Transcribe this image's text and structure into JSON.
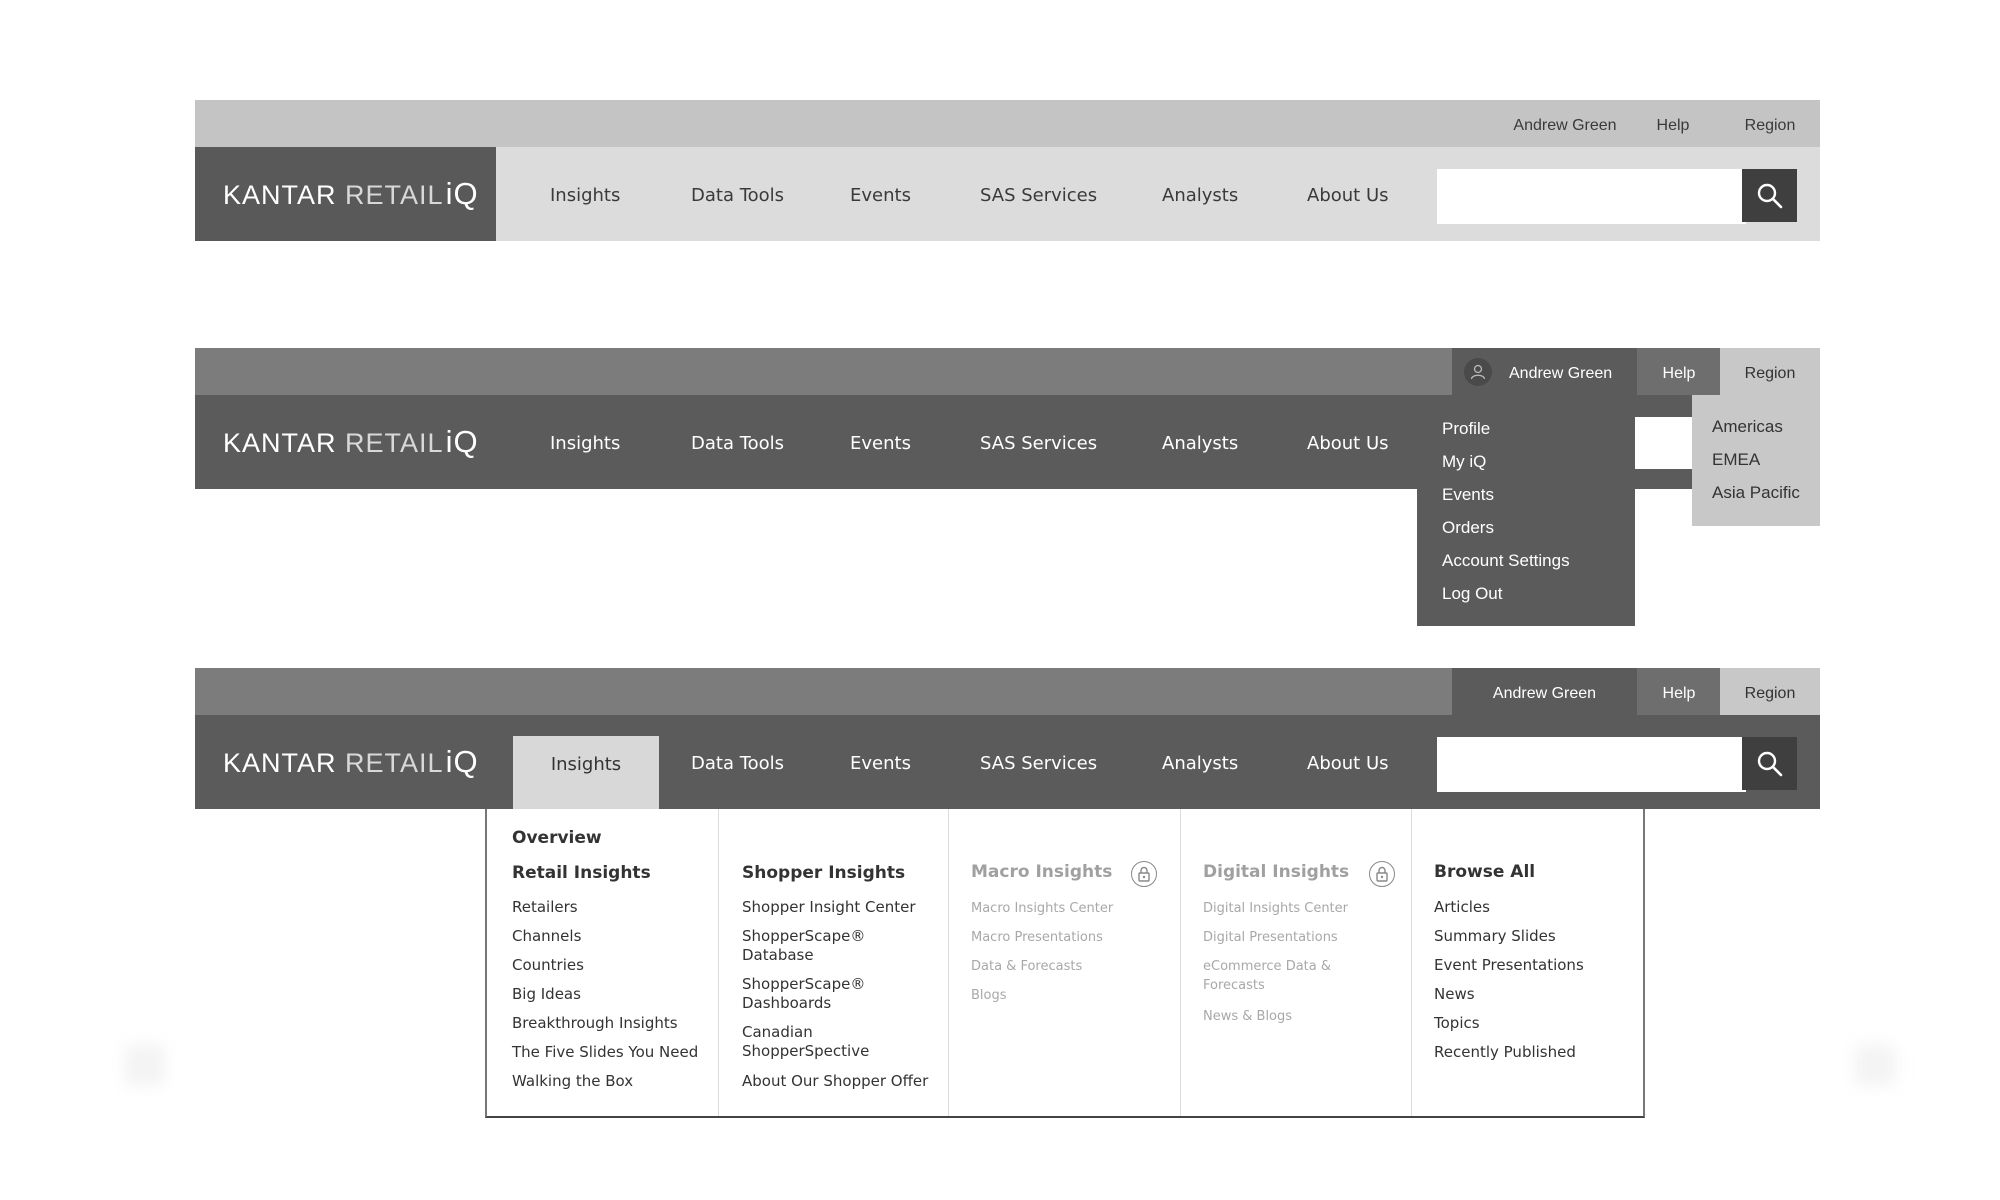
{
  "brand": {
    "part1": "KANTAR",
    "part2": "RETAIL",
    "part3": "iQ"
  },
  "utility": {
    "user": "Andrew Green",
    "help": "Help",
    "region": "Region"
  },
  "nav": [
    "Insights",
    "Data Tools",
    "Events",
    "SAS Services",
    "Analysts",
    "About Us"
  ],
  "search": {
    "placeholder": ""
  },
  "icons": {
    "search": "search-icon",
    "user": "user-icon",
    "lock": "lock-icon"
  },
  "profile_menu": [
    "Profile",
    "My iQ",
    "Events",
    "Orders",
    "Account Settings",
    "Log Out"
  ],
  "region_menu": [
    "Americas",
    "EMEA",
    "Asia Pacific"
  ],
  "mega_menu": {
    "retail": {
      "overview": "Overview",
      "title": "Retail Insights",
      "items": [
        "Retailers",
        "Channels",
        "Countries",
        "Big Ideas",
        "Breakthrough Insights",
        "The Five Slides You Need",
        "Walking the Box"
      ]
    },
    "shopper": {
      "title": "Shopper Insights",
      "items": [
        "Shopper Insight Center",
        "ShopperScape® Database",
        "ShopperScape® Dashboards",
        "Canadian ShopperSpective",
        "About Our Shopper Offer"
      ]
    },
    "macro": {
      "title": "Macro Insights",
      "locked": true,
      "items": [
        "Macro Insights Center",
        "Macro Presentations",
        "Data & Forecasts",
        "Blogs"
      ]
    },
    "digital": {
      "title": "Digital Insights",
      "locked": true,
      "items": [
        "Digital Insights Center",
        "Digital Presentations",
        "eCommerce Data & Forecasts",
        "News & Blogs"
      ]
    },
    "browse": {
      "title": "Browse All",
      "items": [
        "Articles",
        "Summary Slides",
        "Event Presentations",
        "News",
        "Topics",
        "Recently Published"
      ]
    }
  },
  "colors": {
    "dark_bar": "#5b5b5b",
    "utility_dark": "#7c7c7c",
    "light_bar": "#dcdcdc",
    "search_btn": "#3f3f3f"
  }
}
